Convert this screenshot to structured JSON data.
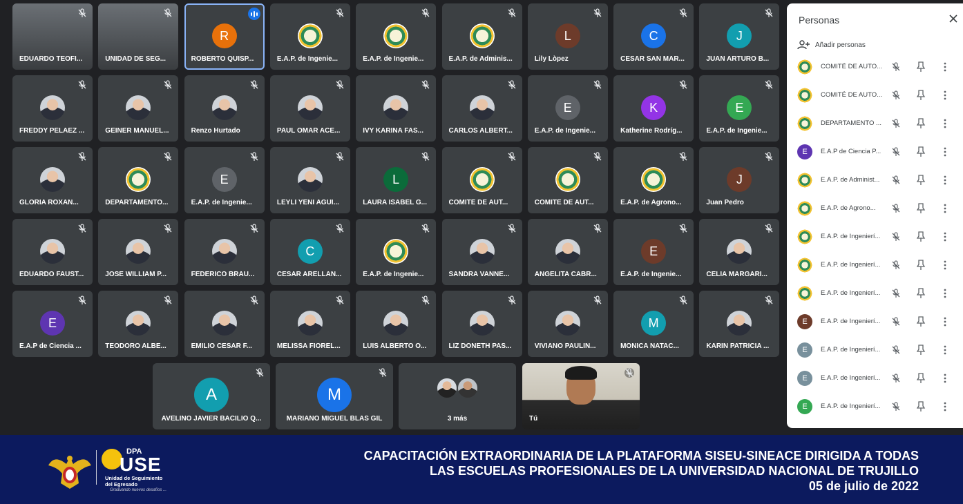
{
  "colors": {
    "tile_bg": "#3c4043",
    "stage_bg": "#202124",
    "banner_bg": "#0c1a5e",
    "panel_bg": "#ffffff",
    "active_outline": "#8ab4f8",
    "speaking": "#1a73e8"
  },
  "grid": {
    "rows": [
      [
        {
          "name": "EDUARDO TEOFI...",
          "avatar": "video"
        },
        {
          "name": "UNIDAD DE SEG...",
          "avatar": "video"
        },
        {
          "name": "ROBERTO QUISP...",
          "avatar": "letter",
          "letter": "R",
          "color": "#e8710a",
          "active": true
        },
        {
          "name": "E.A.P. de Ingenie...",
          "avatar": "logo"
        },
        {
          "name": "E.A.P. de Ingenie...",
          "avatar": "logo"
        },
        {
          "name": "E.A.P. de Adminis...",
          "avatar": "logo"
        },
        {
          "name": "Lily Lòpez",
          "avatar": "letter",
          "letter": "L",
          "color": "#6d3b2a"
        },
        {
          "name": "CESAR SAN MAR...",
          "avatar": "letter",
          "letter": "C",
          "color": "#1a73e8"
        },
        {
          "name": "JUAN ARTURO B...",
          "avatar": "letter",
          "letter": "J",
          "color": "#129eaf"
        }
      ],
      [
        {
          "name": "FREDDY PELAEZ ...",
          "avatar": "photo"
        },
        {
          "name": "GEINER MANUEL...",
          "avatar": "photo"
        },
        {
          "name": "Renzo Hurtado",
          "avatar": "photo"
        },
        {
          "name": "PAUL OMAR ACE...",
          "avatar": "photo"
        },
        {
          "name": "IVY KARINA FAS...",
          "avatar": "photo"
        },
        {
          "name": "CARLOS ALBERT...",
          "avatar": "photo"
        },
        {
          "name": "E.A.P. de Ingenie...",
          "avatar": "letter",
          "letter": "E",
          "color": "#5f6368"
        },
        {
          "name": "Katherine Rodríg...",
          "avatar": "letter",
          "letter": "K",
          "color": "#9334e6"
        },
        {
          "name": "E.A.P. de Ingenie...",
          "avatar": "letter",
          "letter": "E",
          "color": "#34a853"
        }
      ],
      [
        {
          "name": "GLORIA ROXAN...",
          "avatar": "photo"
        },
        {
          "name": "DEPARTAMENTO...",
          "avatar": "logo"
        },
        {
          "name": "E.A.P. de Ingenie...",
          "avatar": "letter",
          "letter": "E",
          "color": "#5f6368"
        },
        {
          "name": "LEYLI YENI AGUI...",
          "avatar": "photo"
        },
        {
          "name": "LAURA ISABEL G...",
          "avatar": "letter",
          "letter": "L",
          "color": "#0b6b3a"
        },
        {
          "name": "COMITÉ DE AUT...",
          "avatar": "logo"
        },
        {
          "name": "COMITÉ DE AUT...",
          "avatar": "logo"
        },
        {
          "name": "E.A.P. de Agrono...",
          "avatar": "logo"
        },
        {
          "name": "Juan Pedro",
          "avatar": "letter",
          "letter": "J",
          "color": "#6d3b2a"
        }
      ],
      [
        {
          "name": "EDUARDO FAUST...",
          "avatar": "photo"
        },
        {
          "name": "JOSE WILLIAM P...",
          "avatar": "photo"
        },
        {
          "name": "FEDERICO BRAU...",
          "avatar": "photo"
        },
        {
          "name": "CESAR ARELLAN...",
          "avatar": "letter",
          "letter": "C",
          "color": "#129eaf"
        },
        {
          "name": "E.A.P. de Ingenie...",
          "avatar": "logo"
        },
        {
          "name": "SANDRA VANNE...",
          "avatar": "photo"
        },
        {
          "name": "ANGELITA CABR...",
          "avatar": "photo"
        },
        {
          "name": "E.A.P. de Ingenie...",
          "avatar": "letter",
          "letter": "E",
          "color": "#6d3b2a"
        },
        {
          "name": "CELIA MARGARI...",
          "avatar": "photo"
        }
      ],
      [
        {
          "name": "E.A.P de Ciencia ...",
          "avatar": "letter",
          "letter": "E",
          "color": "#5e35b1"
        },
        {
          "name": "TEODORO ALBE...",
          "avatar": "photo"
        },
        {
          "name": "EMILIO CESAR F...",
          "avatar": "photo"
        },
        {
          "name": "MELISSA FIOREL...",
          "avatar": "photo"
        },
        {
          "name": "LUIS ALBERTO O...",
          "avatar": "photo"
        },
        {
          "name": "LIZ DONETH PAS...",
          "avatar": "photo"
        },
        {
          "name": "VIVIANO PAULIN...",
          "avatar": "photo"
        },
        {
          "name": "MONICA NATAC...",
          "avatar": "letter",
          "letter": "M",
          "color": "#129eaf"
        },
        {
          "name": "KARIN PATRICIA ...",
          "avatar": "photo"
        }
      ]
    ],
    "bottom": [
      {
        "name": "AVELINO JAVIER BACILIO Q...",
        "avatar": "letter",
        "letter": "A",
        "color": "#129eaf"
      },
      {
        "name": "MARIANO MIGUEL BLAS GIL",
        "avatar": "letter",
        "letter": "M",
        "color": "#1a73e8"
      },
      {
        "name": "3 más",
        "avatar": "group"
      },
      {
        "name": "Tú",
        "avatar": "video"
      }
    ]
  },
  "panel": {
    "title": "Personas",
    "add_label": "Añadir personas",
    "rows": [
      {
        "name": "COMITÉ DE AUTO...",
        "avatar": "logo"
      },
      {
        "name": "COMITÉ DE AUTO...",
        "avatar": "logo"
      },
      {
        "name": "DEPARTAMENTO ...",
        "avatar": "logo"
      },
      {
        "name": "E.A.P de Ciencia P...",
        "avatar": "letter",
        "letter": "E",
        "color": "#5e35b1"
      },
      {
        "name": "E.A.P. de Administ...",
        "avatar": "logo"
      },
      {
        "name": "E.A.P. de Agrono...",
        "avatar": "logo"
      },
      {
        "name": "E.A.P. de Ingenierí...",
        "avatar": "logo"
      },
      {
        "name": "E.A.P. de Ingenierí...",
        "avatar": "logo"
      },
      {
        "name": "E.A.P. de Ingenierí...",
        "avatar": "logo"
      },
      {
        "name": "E.A.P. de Ingenierí...",
        "avatar": "letter",
        "letter": "E",
        "color": "#6d3b2a"
      },
      {
        "name": "E.A.P. de Ingenierí...",
        "avatar": "letter",
        "letter": "E",
        "color": "#78909c"
      },
      {
        "name": "E.A.P. de Ingenierí...",
        "avatar": "letter",
        "letter": "E",
        "color": "#78909c"
      },
      {
        "name": "E.A.P. de Ingenierí...",
        "avatar": "letter",
        "letter": "E",
        "color": "#34a853"
      }
    ]
  },
  "banner": {
    "line1": "CAPACITACIÓN EXTRAORDINARIA DE LA PLATAFORMA SISEU-SINEACE DIRIGIDA A TODAS",
    "line2": "LAS ESCUELAS PROFESIONALES  DE LA UNIVERSIDAD NACIONAL DE TRUJILLO",
    "line3": "05 de julio de 2022",
    "logo_dpa": "DPA",
    "logo_use": "USE",
    "logo_sub1": "Unidad de Seguimiento",
    "logo_sub2": "del Egresado",
    "logo_slogan": "Graduando nuevos desafíos ..."
  }
}
